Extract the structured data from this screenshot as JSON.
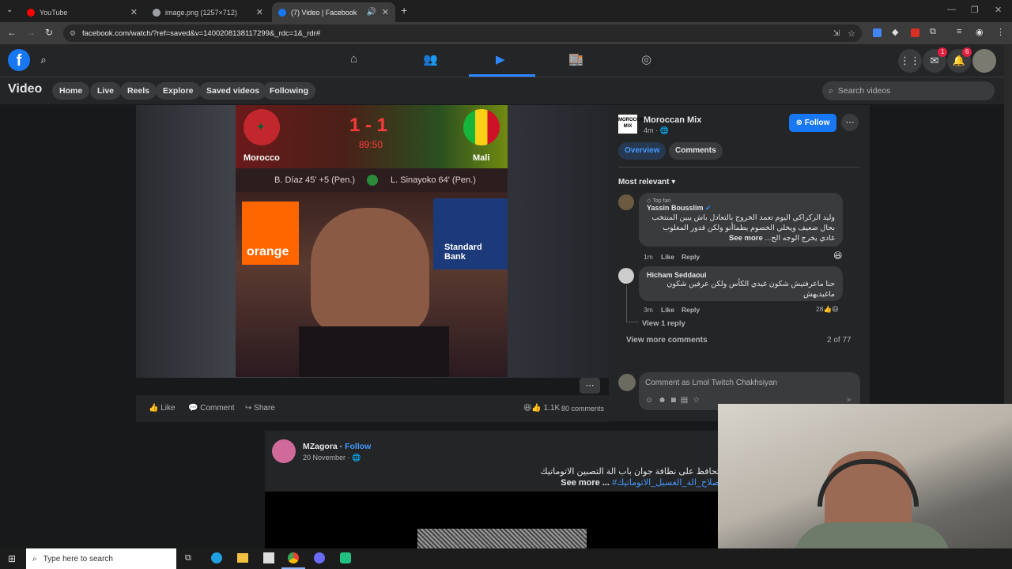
{
  "browser": {
    "tabs": [
      {
        "title": "YouTube",
        "color": "#ff0000"
      },
      {
        "title": "image.png (1257×712)",
        "color": "#9aa0a6"
      },
      {
        "title": "(7) Video | Facebook",
        "color": "#1877f2"
      }
    ],
    "url": "facebook.com/watch/?ref=saved&v=1400208138117299&_rdc=1&_rdr#"
  },
  "fb": {
    "section_title": "Video",
    "subnav": [
      "Home",
      "Live",
      "Reels",
      "Explore",
      "Saved videos",
      "Following"
    ],
    "search_placeholder": "Search videos",
    "messenger_badge": "1",
    "notif_badge": "6"
  },
  "video": {
    "home_team": "Morocco",
    "away_team": "Mali",
    "score": "1 - 1",
    "clock": "89:50",
    "home_scorer": "B. Díaz 45' +5 (Pen.)",
    "away_scorer": "L. Sinayoko 64' (Pen.)",
    "ad_left": "orange",
    "ad_right": "Standard Bank",
    "like": "Like",
    "comment": "Comment",
    "share": "Share",
    "reactions": "1.1K",
    "comments": "80 comments"
  },
  "panel": {
    "page_name": "Moroccan Mix",
    "logo_text": "MOROCCAN MIX",
    "time": "4m",
    "follow": "Follow",
    "tab_overview": "Overview",
    "tab_comments": "Comments",
    "sort": "Most relevant",
    "comments": [
      {
        "badge": "Top fan",
        "name": "Yassin Bousslim",
        "text1": "وليد الركراكي اليوم تعمد الخروج بالتعادل باش يبين المنتخب",
        "text2": "بحال ضعيف ويخلي الخصوم يطماأنو ولكن قدور المغلوب",
        "text3": "غادي يخرج الوجه الح...",
        "see_more": "See more",
        "time": "1m",
        "like": "Like",
        "reply": "Reply"
      },
      {
        "name": "Hicham Seddaoui",
        "text1": "حنا ماعرفتيش شكون غيدي الكأس ولكن عرفين شكون",
        "text2": "ماغيديهش",
        "time": "3m",
        "like": "Like",
        "reply": "Reply",
        "count": "28"
      }
    ],
    "view_reply": "View 1 reply",
    "view_more": "View more comments",
    "pager": "2 of 77",
    "comment_placeholder": "Comment as Lmol Twitch Chakhsiyan"
  },
  "post": {
    "name": "MZagora",
    "follow": "Follow",
    "date": "20 November",
    "text": "تحافظ على نظافة جوان باب الة التصبين الاتوماتيك",
    "see_more": "See more ...",
    "hashtag": "#صلاح_الة_الغسيل_الاتوماتيك"
  },
  "taskbar": {
    "search": "Type here to search"
  }
}
